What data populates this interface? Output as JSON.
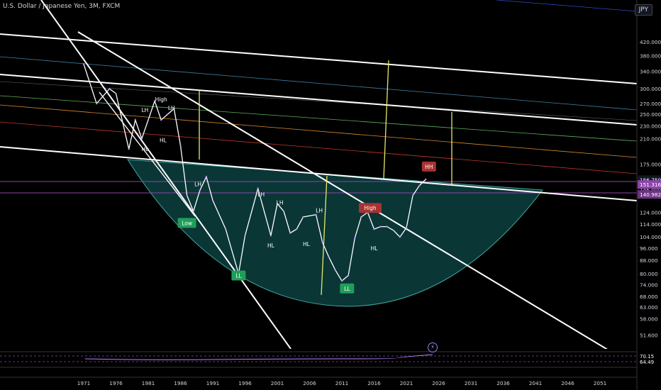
{
  "header": {
    "symbol": "U.S. Dollar / Japanese Yen, 3M, FXCM",
    "currency_button": "JPY",
    "event_marker": "⚡"
  },
  "price_axis": {
    "ticks": [
      "420.000",
      "380.000",
      "340.000",
      "300.000",
      "270.000",
      "250.000",
      "230.000",
      "210.000",
      "175.000",
      "146.000",
      "124.000",
      "114.000",
      "104.000",
      "96.000",
      "88.000",
      "80.000",
      "74.000",
      "68.000",
      "63.000",
      "58.000",
      "51.600"
    ],
    "last_price": "156.750",
    "countdown": "1M 2d",
    "level_1": "151.316",
    "level_2": "140.982"
  },
  "time_axis": {
    "ticks": [
      "1971",
      "1976",
      "1981",
      "1986",
      "1991",
      "1996",
      "2001",
      "2006",
      "2011",
      "2016",
      "2021",
      "2026",
      "2031",
      "2036",
      "2041",
      "2046",
      "2051"
    ]
  },
  "annotations": {
    "high_top": "High",
    "lh": "LH",
    "hl": "HL",
    "low": "Low",
    "ll": "LL",
    "high_mid": "High",
    "hh": "HH"
  },
  "oscillator": {
    "value_1": "70.15",
    "value_2": "64.49"
  },
  "colors": {
    "background": "#000000",
    "cup_fill": "#0e4b4b",
    "candle": "#ffffff",
    "wave": "#c58bff",
    "projection": "#e8e86a",
    "purple_level": "#8e44ad",
    "red_label": "#a83232",
    "green_label": "#1f9e5a"
  },
  "chart_data": {
    "type": "line",
    "title": "U.S. Dollar / Japanese Yen, 3M, FXCM",
    "xlabel": "",
    "ylabel": "",
    "y_scale": "log",
    "xlim": [
      1968,
      2055
    ],
    "ylim": [
      49,
      460
    ],
    "grid": false,
    "series": [
      {
        "x": [
          1971,
          1973,
          1975,
          1976,
          1978,
          1979,
          1980,
          1981,
          1982,
          1983,
          1984,
          1985,
          1986,
          1987,
          1988,
          1989,
          1990,
          1991,
          1993,
          1995,
          1996,
          1998,
          2000,
          2001,
          2002,
          2003,
          2004,
          2005,
          2007,
          2008,
          2009,
          2010,
          2011,
          2012,
          2013,
          2014,
          2015,
          2016,
          2017,
          2018,
          2019,
          2020,
          2021,
          2022,
          2023,
          2024
        ],
        "values": [
          358,
          270,
          300,
          290,
          195,
          240,
          210,
          240,
          275,
          240,
          250,
          260,
          200,
          140,
          125,
          145,
          160,
          135,
          110,
          80,
          105,
          147,
          105,
          132,
          125,
          107,
          110,
          120,
          122,
          100,
          90,
          82,
          76,
          79,
          103,
          120,
          124,
          110,
          112,
          112,
          109,
          104,
          111,
          140,
          150,
          157
        ]
      }
    ],
    "annotations": [
      {
        "x": 1983,
        "y": 278,
        "label": "High"
      },
      {
        "x": 1980.5,
        "y": 258,
        "label": "LH"
      },
      {
        "x": 1984.6,
        "y": 262,
        "label": "LH"
      },
      {
        "x": 1988.7,
        "y": 152,
        "label": "LH"
      },
      {
        "x": 1998.5,
        "y": 141,
        "label": "LH"
      },
      {
        "x": 2001.4,
        "y": 133,
        "label": "LH"
      },
      {
        "x": 2007.5,
        "y": 126,
        "label": "LH"
      },
      {
        "x": 1980.5,
        "y": 195,
        "label": "HL"
      },
      {
        "x": 1983.3,
        "y": 208,
        "label": "HL"
      },
      {
        "x": 2000,
        "y": 98,
        "label": "HL"
      },
      {
        "x": 2005.5,
        "y": 99,
        "label": "HL"
      },
      {
        "x": 2016,
        "y": 96,
        "label": "HL"
      },
      {
        "x": 1987,
        "y": 115,
        "label": "Low"
      },
      {
        "x": 1995,
        "y": 79,
        "label": "LL"
      },
      {
        "x": 2011.8,
        "y": 72,
        "label": "LL"
      },
      {
        "x": 2015.4,
        "y": 128,
        "label": "High"
      },
      {
        "x": 2024.5,
        "y": 172,
        "label": "HH"
      }
    ]
  }
}
